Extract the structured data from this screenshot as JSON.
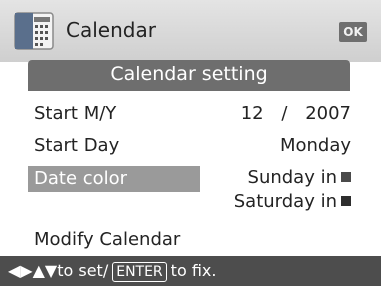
{
  "header": {
    "title": "Calendar",
    "ok_label": "OK",
    "app_icon": "calendar-grid-icon"
  },
  "section": {
    "title": "Calendar setting"
  },
  "rows": {
    "start_my": {
      "label": "Start M/Y",
      "month": "12",
      "separator": "/",
      "year": "2007"
    },
    "start_day": {
      "label": "Start Day",
      "value": "Monday"
    },
    "date_color": {
      "label": "Date color",
      "sunday_text": "Sunday in",
      "saturday_text": "Saturday in",
      "sunday_color": "#4a4a4a",
      "saturday_color": "#2e2e2e"
    },
    "modify": {
      "label": "Modify Calendar"
    }
  },
  "footer": {
    "nav_arrows": "◀▶▲▼",
    "to_set": "to set/",
    "enter_key": "ENTER",
    "to_fix": "to fix."
  },
  "colors": {
    "header_bar": "#6e6e6e",
    "selection": "#9a9a9a",
    "footer_bar": "#4d4d4d"
  }
}
